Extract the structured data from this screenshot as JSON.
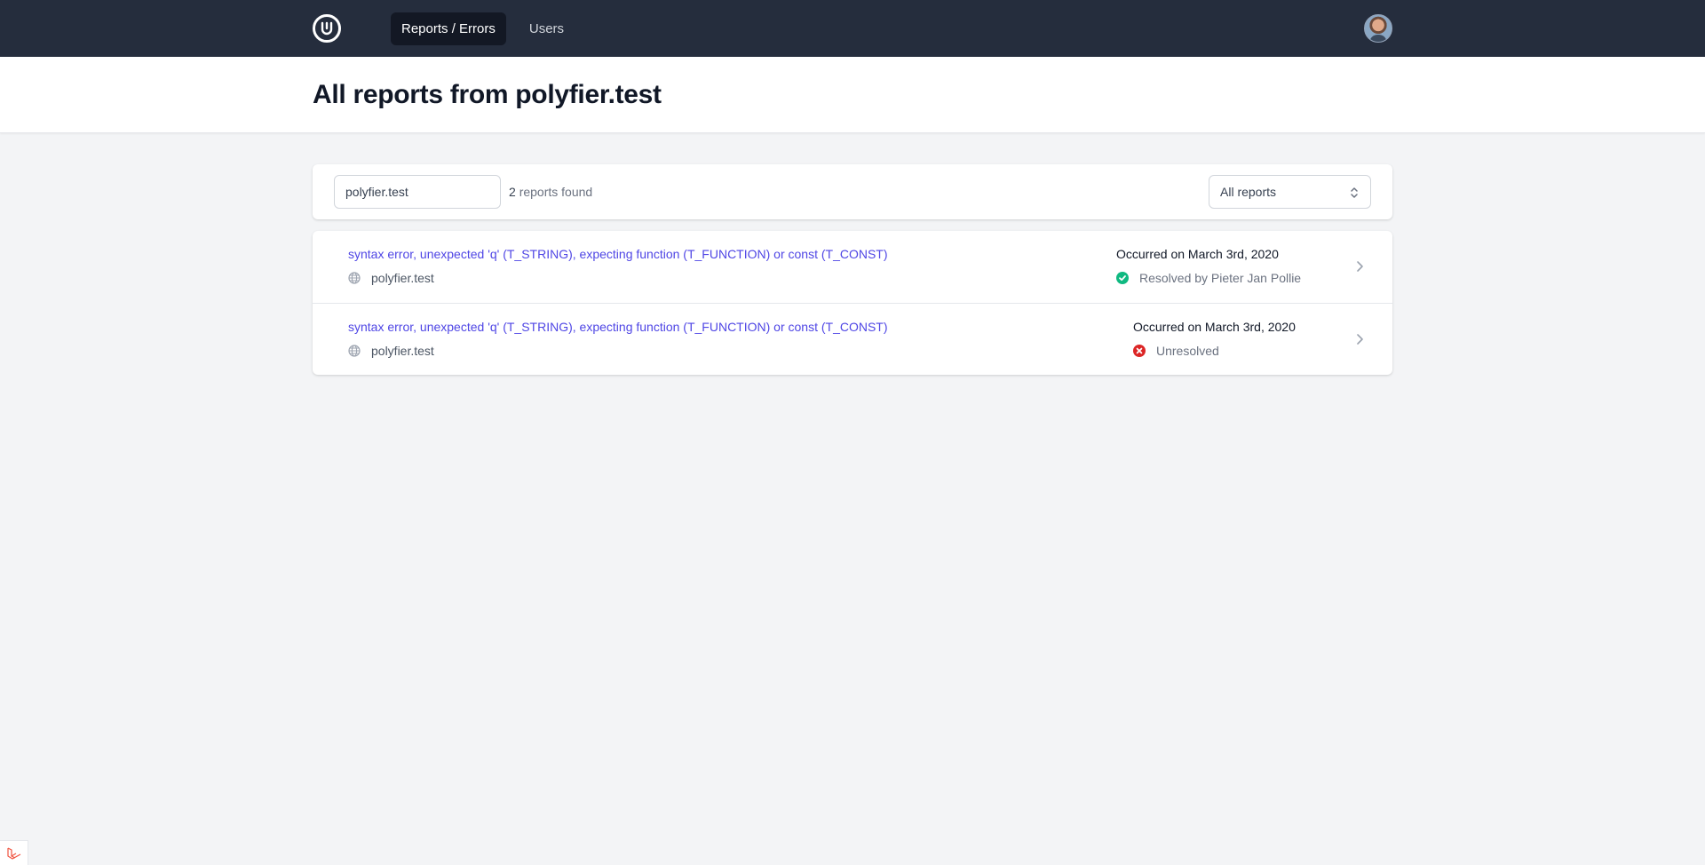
{
  "nav": {
    "items": [
      {
        "label": "Reports / Errors",
        "active": true
      },
      {
        "label": "Users",
        "active": false
      }
    ]
  },
  "header": {
    "title": "All reports from polyfier.test"
  },
  "filters": {
    "search_value": "polyfier.test",
    "count_number": "2",
    "count_text": "reports found",
    "select_value": "All reports"
  },
  "reports": [
    {
      "title": "syntax error, unexpected 'q' (T_STRING), expecting function (T_FUNCTION) or const (T_CONST)",
      "host": "polyfier.test",
      "date": "Occurred on March 3rd, 2020",
      "status": "Resolved by Pieter Jan Pollie",
      "status_type": "resolved"
    },
    {
      "title": "syntax error, unexpected 'q' (T_STRING), expecting function (T_FUNCTION) or const (T_CONST)",
      "host": "polyfier.test",
      "date": "Occurred on March 3rd, 2020",
      "status": "Unresolved",
      "status_type": "unresolved"
    }
  ],
  "colors": {
    "topbar": "#252d3d",
    "link": "#4f46e5",
    "resolved": "#10b981",
    "unresolved": "#dc2626"
  }
}
